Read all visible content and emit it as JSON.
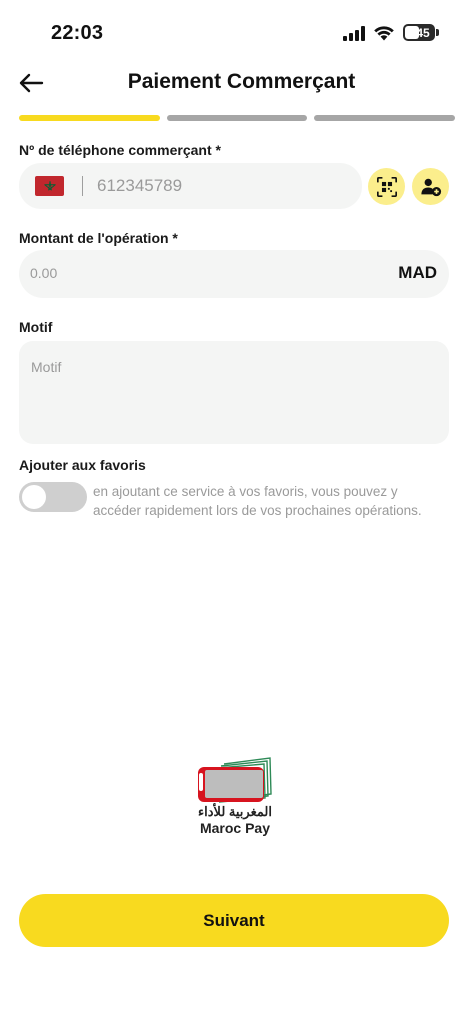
{
  "status_bar": {
    "time": "22:03",
    "battery": "45"
  },
  "header": {
    "title": "Paiement Commerçant",
    "back_icon": "arrow-left-icon"
  },
  "progress": {
    "steps": 3,
    "current_step": 1,
    "active_color": "#f8da1f",
    "inactive_color": "#a6a6a6"
  },
  "phone": {
    "label": "Nº de téléphone commerçant *",
    "value": "612345789",
    "country_flag": "morocco-flag-icon",
    "qr_icon": "qr-scan-icon",
    "contact_icon": "add-contact-icon"
  },
  "amount": {
    "label": "Montant de l'opération *",
    "placeholder": "0.00",
    "currency": "MAD"
  },
  "motif": {
    "label": "Motif",
    "placeholder": "Motif"
  },
  "favorites": {
    "label": "Ajouter aux favoris",
    "enabled": false,
    "description": "en ajoutant ce service à vos favoris, vous pouvez y accéder rapidement lors de vos prochaines opérations."
  },
  "brand": {
    "name_ar": "المغربية للأداء",
    "name_en": "Maroc Pay"
  },
  "footer": {
    "next_label": "Suivant"
  },
  "colors": {
    "accent": "#f8da1f",
    "field_bg": "#f4f5f4",
    "icon_bg": "#fbee8c"
  }
}
